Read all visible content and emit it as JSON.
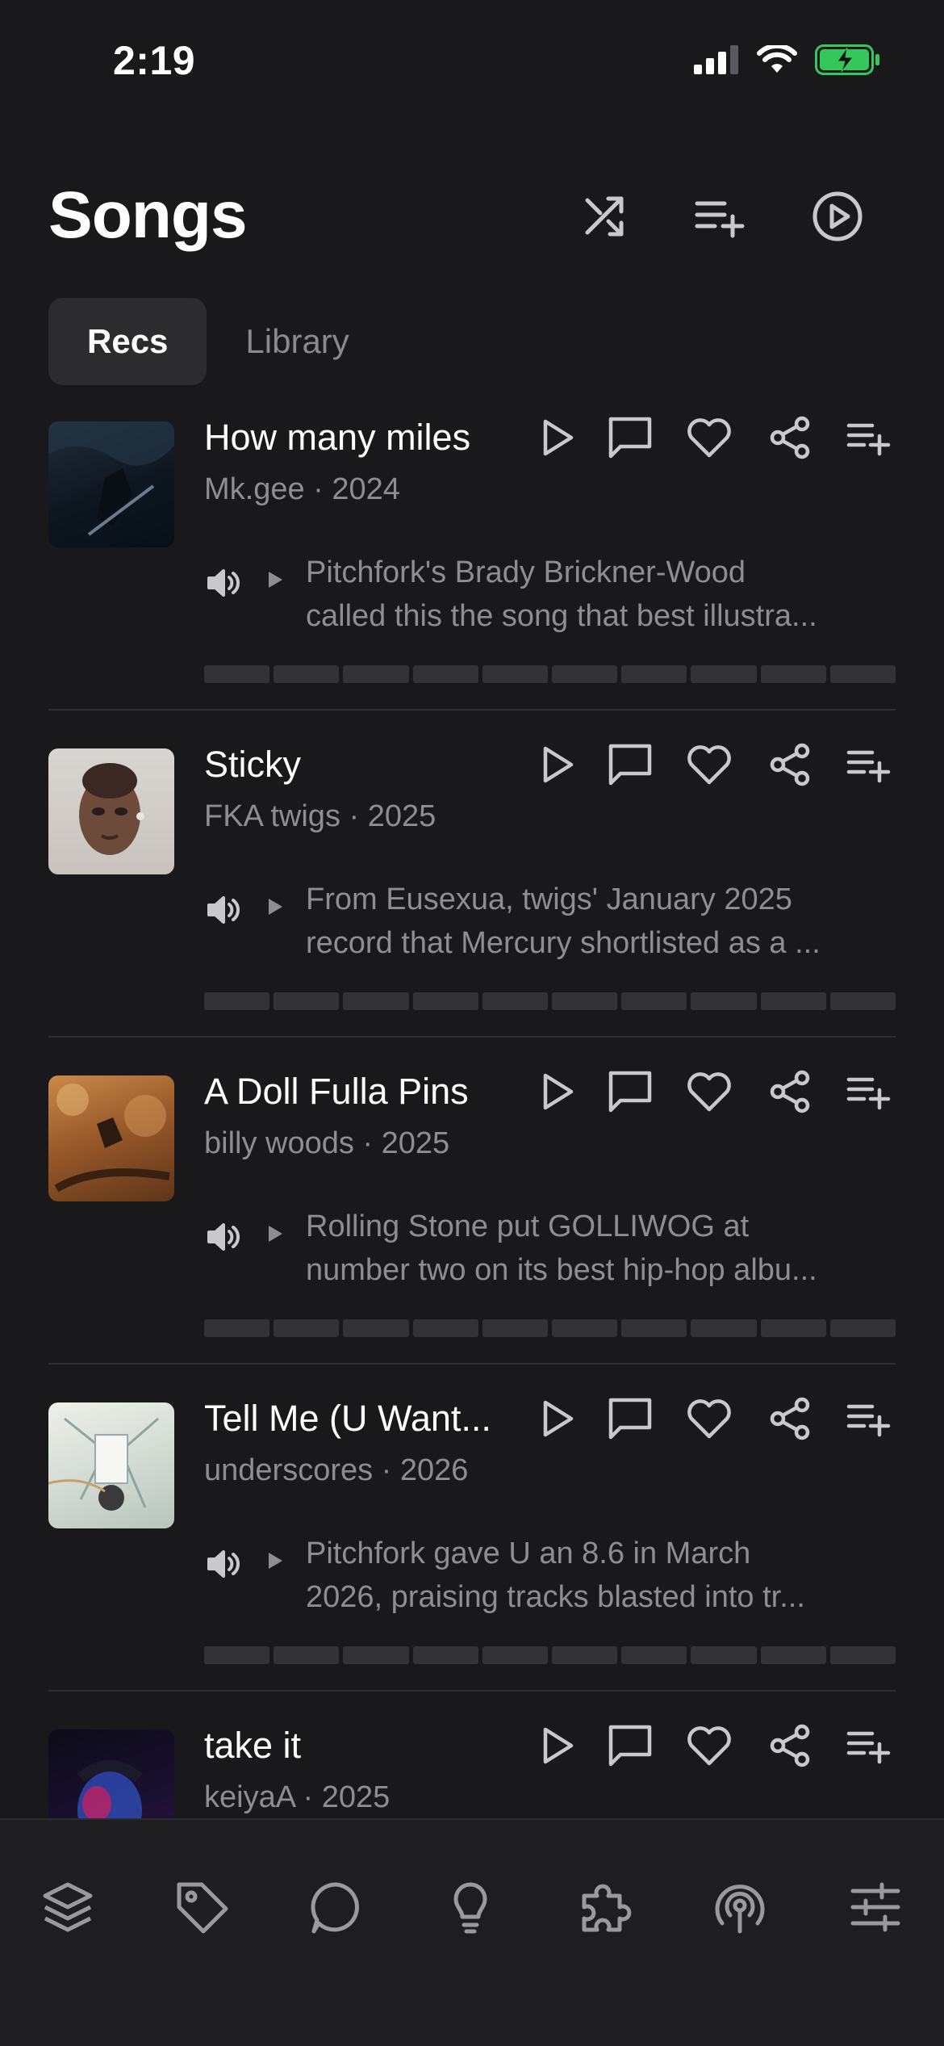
{
  "status_bar": {
    "time": "2:19",
    "icons": [
      "cellular-signal-icon",
      "wifi-icon",
      "battery-charging-icon"
    ],
    "battery_color": "#34c759"
  },
  "header": {
    "title": "Songs",
    "actions": [
      "shuffle-icon",
      "add-to-queue-icon",
      "play-circle-icon"
    ]
  },
  "tabs": [
    {
      "label": "Recs",
      "active": true
    },
    {
      "label": "Library",
      "active": false
    }
  ],
  "song_actions": [
    "play-icon",
    "comment-icon",
    "heart-icon",
    "share-icon",
    "add-to-playlist-icon"
  ],
  "songs": [
    {
      "title": "How many miles",
      "meta": "Mk.gee · 2024",
      "blurb_line1": "Pitchfork's Brady Brickner-Wood",
      "blurb_line2": "called this the song that best illustra...",
      "progress_fraction": 0
    },
    {
      "title": "Sticky",
      "meta": "FKA twigs · 2025",
      "blurb_line1": "From Eusexua, twigs' January 2025",
      "blurb_line2": "record that Mercury shortlisted as a ...",
      "progress_fraction": 0
    },
    {
      "title": "A Doll Fulla Pins",
      "meta": "billy woods · 2025",
      "blurb_line1": "Rolling Stone put GOLLIWOG at",
      "blurb_line2": "number two on its best hip-hop albu...",
      "progress_fraction": 0
    },
    {
      "title": "Tell Me (U Want...",
      "meta": "underscores · 2026",
      "blurb_line1": "Pitchfork gave U an 8.6 in March",
      "blurb_line2": "2026, praising tracks blasted into tr...",
      "progress_fraction": 0
    },
    {
      "title": "take it",
      "meta": "keiyaA · 2025",
      "blurb_line1": "",
      "blurb_line2": "",
      "progress_fraction": 0
    }
  ],
  "tab_bar": {
    "icons": [
      "stack-icon",
      "tag-icon",
      "chat-icon",
      "lightbulb-icon",
      "puzzle-icon",
      "broadcast-icon",
      "sliders-icon"
    ]
  },
  "colors": {
    "background": "#19191b",
    "secondary_text": "#8d8d92",
    "icon": "#c9c9cd"
  }
}
